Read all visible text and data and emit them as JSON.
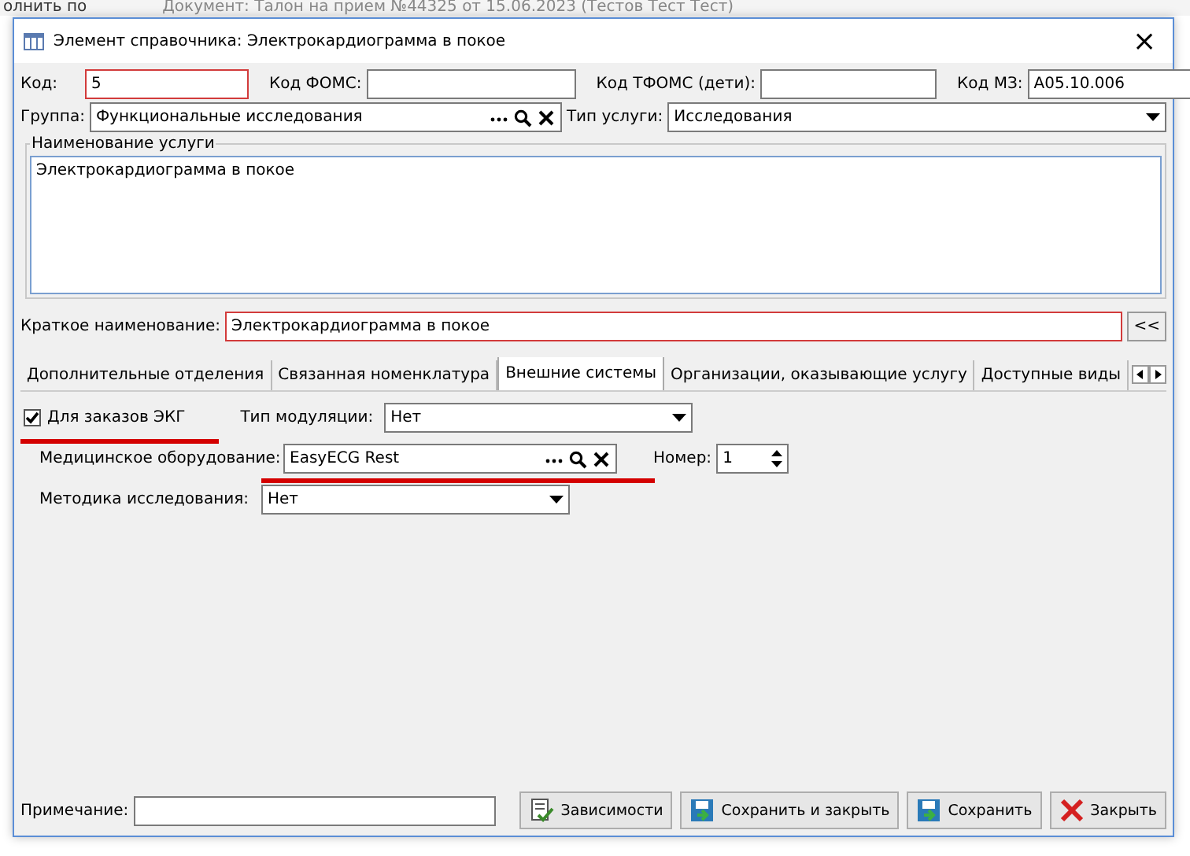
{
  "background": {
    "button": "олнить по",
    "document_title": "Документ: Талон на прием №44325 от 15.06.2023 (Тестов Тест Тест)"
  },
  "window": {
    "title": "Элемент справочника: Электрокардиограмма в покое",
    "close": "×"
  },
  "fields": {
    "code_label": "Код:",
    "code": "5",
    "foms_label": "Код ФОМС:",
    "tfoms_label": "Код ТФОМС (дети):",
    "mz_label": "Код МЗ:",
    "mz": "A05.10.006",
    "group_label": "Группа:",
    "group": "Функциональные исследования",
    "service_type_label": "Тип услуги:",
    "service_type": "Исследования"
  },
  "name_group": {
    "legend": "Наименование услуги",
    "value": "Электрокардиограмма в покое"
  },
  "short_name": {
    "label": "Краткое наименование:",
    "value": "Электрокардиограмма в покое",
    "button": "<<"
  },
  "tabs": [
    {
      "label": "Дополнительные отделения",
      "selected": false
    },
    {
      "label": "Связанная номенклатура",
      "selected": false
    },
    {
      "label": "Внешние системы",
      "selected": true
    },
    {
      "label": "Организации, оказывающие услугу",
      "selected": false
    },
    {
      "label": "Доступные виды",
      "selected": false
    }
  ],
  "external": {
    "ecg_orders": {
      "label": "Для заказов ЭКГ",
      "checked": true
    },
    "modulation_label": "Тип модуляции:",
    "modulation": "Нет",
    "equipment_label": "Медицинское оборудование:",
    "equipment": "EasyECG Rest",
    "number_label": "Номер:",
    "number": "1",
    "method_label": "Методика исследования:",
    "method": "Нет"
  },
  "footer": {
    "note_label": "Примечание:",
    "buttons": [
      {
        "label": "Зависимости",
        "kind": "deps"
      },
      {
        "label": "Сохранить и закрыть",
        "kind": "save"
      },
      {
        "label": "Сохранить",
        "kind": "save"
      },
      {
        "label": "Закрыть",
        "kind": "close"
      }
    ]
  }
}
